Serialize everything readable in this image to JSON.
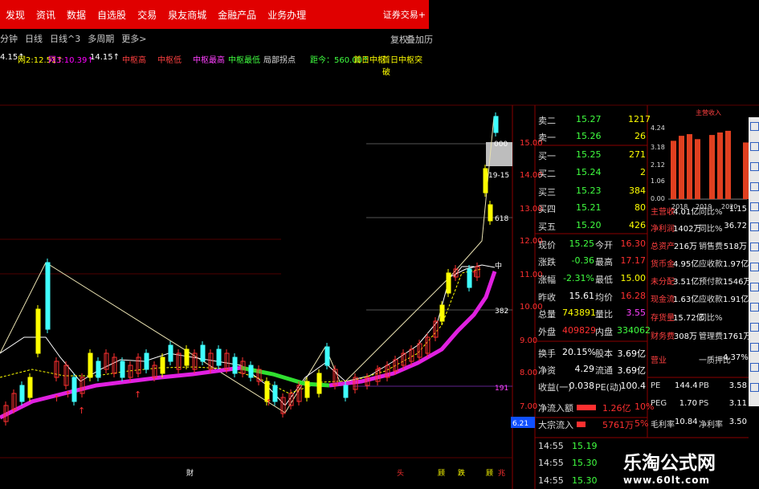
{
  "menu": {
    "items": [
      "发现",
      "资讯",
      "数据",
      "自选股",
      "交易",
      "泉友商城",
      "金融产品",
      "业务办理"
    ],
    "right": "证券交易+"
  },
  "toolbar": {
    "items": [
      "分钟",
      "日线",
      "日线^3",
      "多周期",
      "更多>"
    ],
    "right": [
      "复权",
      "叠加",
      "历"
    ]
  },
  "indicators": {
    "ma": [
      {
        "label": "4.15↑",
        "color": "#ffffff"
      },
      {
        "label": "网2:12.51↑",
        "color": "#ffff00"
      },
      {
        "label": "网3:10.39↑",
        "color": "#ff00ff"
      },
      {
        "label": "14.15↑",
        "color": "#ffffff"
      }
    ],
    "lines": [
      {
        "label": "中枢高",
        "color": "#ff4040"
      },
      {
        "label": "中枢低",
        "color": "#ff4040"
      },
      {
        "label": "中枢最高",
        "color": "#ff40ff"
      },
      {
        "label": "中枢最低",
        "color": "#40ff40"
      },
      {
        "label": "局部拐点",
        "color": "#dddddd"
      }
    ],
    "distance": "距今：560.00↑",
    "tag1": "首日中枢",
    "tag2": "首日中枢突破"
  },
  "price_axis": {
    "labels": [
      "15.00",
      "14.00",
      "13.00",
      "12.00",
      "11.00",
      "10.00",
      "9.00",
      "8.00",
      "7.00"
    ]
  },
  "chart_notes": {
    "ref1": "19-15",
    "ref2": "618",
    "ref3": "382",
    "ref4": "191",
    "mid": "中",
    "box": "000"
  },
  "bottom_markers": {
    "m1": "財",
    "m2": "头",
    "m3": "顾",
    "m4": "跌",
    "m5": "顾",
    "m6": "兆"
  },
  "left_time": "6.21",
  "orderbook": [
    {
      "side": "卖二",
      "price": "15.27",
      "vol": "1217"
    },
    {
      "side": "卖一",
      "price": "15.26",
      "vol": "26"
    },
    {
      "side": "买一",
      "price": "15.25",
      "vol": "271"
    },
    {
      "side": "买二",
      "price": "15.24",
      "vol": "2"
    },
    {
      "side": "买三",
      "price": "15.23",
      "vol": "384"
    },
    {
      "side": "买四",
      "price": "15.21",
      "vol": "80"
    },
    {
      "side": "买五",
      "price": "15.20",
      "vol": "426"
    }
  ],
  "stats": [
    {
      "l1": "现价",
      "v1": "15.25",
      "l2": "今开",
      "v2": "16.30",
      "c1": "#40ff40",
      "c2": "#ff3030"
    },
    {
      "l1": "涨跌",
      "v1": "-0.36",
      "l2": "最高",
      "v2": "17.17",
      "c1": "#40ff40",
      "c2": "#ff3030"
    },
    {
      "l1": "涨幅",
      "v1": "-2.31%",
      "l2": "最低",
      "v2": "15.00",
      "c1": "#40ff40",
      "c2": "#ffff00"
    },
    {
      "l1": "昨收",
      "v1": "15.61",
      "l2": "均价",
      "v2": "16.28",
      "c1": "#ffffff",
      "c2": "#ff3030"
    },
    {
      "l1": "总量",
      "v1": "743891",
      "l2": "量比",
      "v2": "3.55",
      "c1": "#ffff00",
      "c2": "#ff40ff"
    },
    {
      "l1": "外盘",
      "v1": "409829",
      "l2": "内盘",
      "v2": "334062",
      "c1": "#ff3030",
      "c2": "#40ff40"
    }
  ],
  "stats2": [
    {
      "l1": "换手",
      "v1": "20.15%",
      "l2": "股本",
      "v2": "3.69亿"
    },
    {
      "l1": "净资",
      "v1": "4.29",
      "l2": "流通",
      "v2": "3.69亿"
    },
    {
      "l1": "收益(一)",
      "v1": "0.038",
      "l2": "PE(动)",
      "v2": "100.4"
    }
  ],
  "flows": [
    {
      "label": "净流入额",
      "value": "1.26亿",
      "pct": "10%",
      "bar": 0.6
    },
    {
      "label": "大宗流入",
      "value": "5761万",
      "pct": "5%",
      "bar": 0.28
    }
  ],
  "ticks": [
    {
      "time": "14:55",
      "price": "15.19"
    },
    {
      "time": "14:55",
      "price": "15.30"
    },
    {
      "time": "14:55",
      "price": "15.30"
    }
  ],
  "mini_chart": {
    "title": "主营收入",
    "y_ticks": [
      "4.24",
      "3.18",
      "2.12",
      "1.06",
      "0.00"
    ],
    "x_ticks": [
      "2018",
      "2019",
      "2020"
    ]
  },
  "mini_bars": [
    3.5,
    3.8,
    3.9,
    3.6,
    3.85,
    4.0,
    4.1,
    3.4
  ],
  "fundamentals": [
    {
      "l1": "主营收",
      "v1": "4.01亿",
      "l2": "同比%",
      "v2": "1.15"
    },
    {
      "l1": "净利润",
      "v1": "1402万",
      "l2": "同比%",
      "v2": "36.72"
    },
    {
      "l1": "总资产",
      "v1": "216万",
      "l2": "销售费",
      "v2": "518万"
    },
    {
      "l1": "货币金",
      "v1": "4.95亿",
      "l2": "应收款",
      "v2": "1.97亿"
    },
    {
      "l1": "未分配",
      "v1": "3.51亿",
      "l2": "预付款",
      "v2": "1546万"
    },
    {
      "l1": "现金流",
      "v1": "1.63亿",
      "l2": "应收款",
      "v2": "1.91亿"
    },
    {
      "l1": "存货量",
      "v1": "15.72亿",
      "l2": "同比%",
      "v2": ""
    },
    {
      "l1": "财务费",
      "v1": "308万",
      "l2": "管理费",
      "v2": "1761万"
    },
    {
      "l1": "营业",
      "v1": "",
      "l2": "一质押比",
      "v2": "4.37%"
    }
  ],
  "valuation": [
    {
      "l1": "PE",
      "v1": "144.4",
      "l2": "PB",
      "v2": "3.58"
    },
    {
      "l1": "PEG",
      "v1": "1.70",
      "l2": "PS",
      "v2": "3.11"
    },
    {
      "l1": "毛利率",
      "v1": "10.84",
      "l2": "净利率",
      "v2": "3.50"
    }
  ],
  "watermark": {
    "title": "乐淘公式网",
    "url": "www.60lt.com"
  },
  "colors": {
    "up": "#ff3030",
    "down": "#40ffff",
    "ma_yellow": "#ffff00",
    "ma_magenta": "#e020e0",
    "ma_green": "#30e030",
    "grid_red": "#8b0000"
  }
}
